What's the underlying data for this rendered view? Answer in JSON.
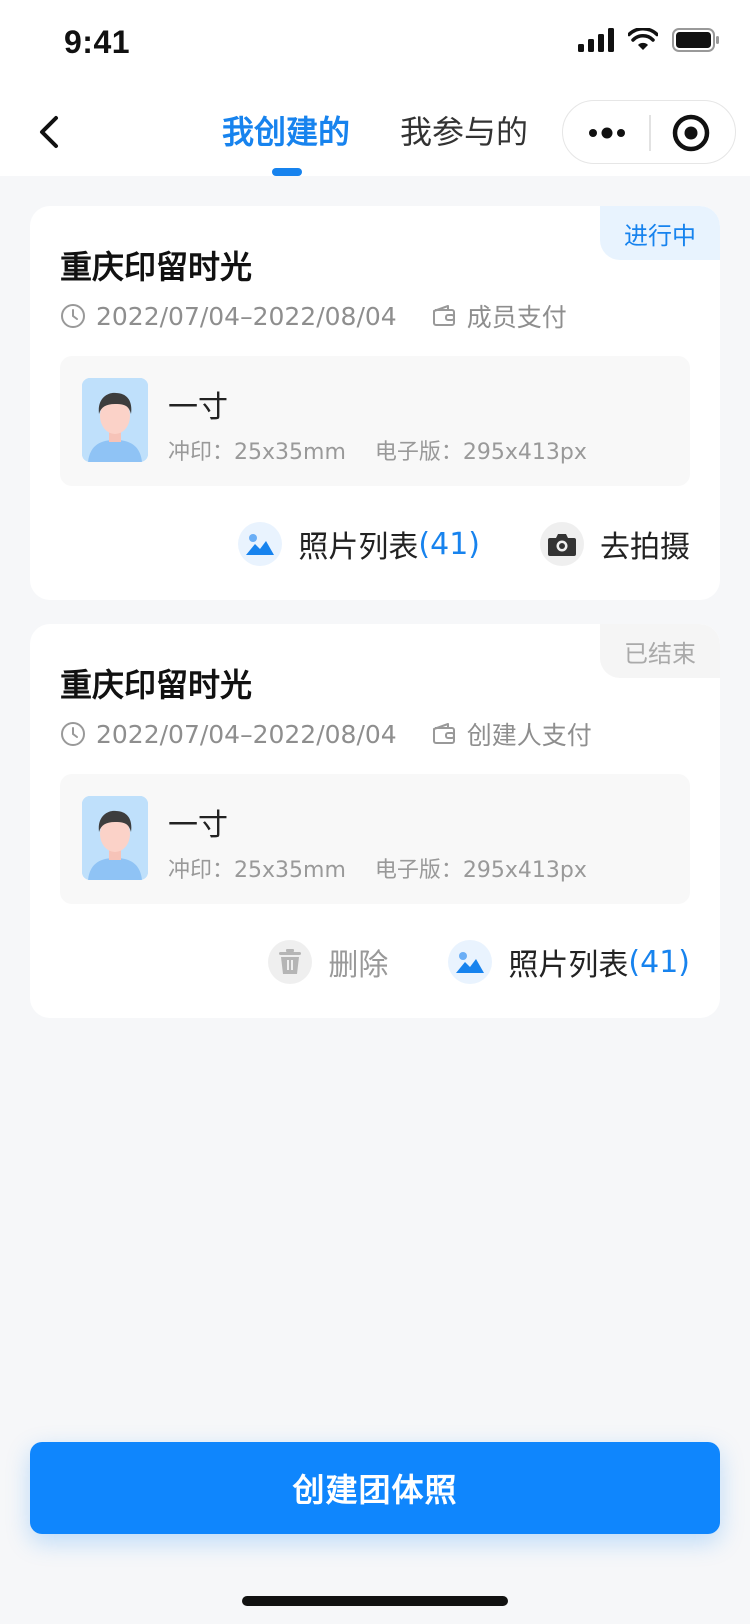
{
  "status_bar": {
    "time": "9:41"
  },
  "nav": {
    "tabs": [
      {
        "label": "我创建的",
        "active": true
      },
      {
        "label": "我参与的",
        "active": false
      }
    ]
  },
  "cards": [
    {
      "title": "重庆印留时光",
      "status": "进行中",
      "date_range": "2022/07/04–2022/08/04",
      "payment": "成员支付",
      "size": {
        "name": "一寸",
        "print": "冲印：25x35mm",
        "digital": "电子版：295x413px"
      },
      "actions": [
        {
          "label": "照片列表",
          "count": "(41)",
          "icon": "photo-icon"
        },
        {
          "label": "去拍摄",
          "count": "",
          "icon": "camera-icon"
        }
      ]
    },
    {
      "title": "重庆印留时光",
      "status": "已结束",
      "date_range": "2022/07/04–2022/08/04",
      "payment": "创建人支付",
      "size": {
        "name": "一寸",
        "print": "冲印：25x35mm",
        "digital": "电子版：295x413px"
      },
      "actions": [
        {
          "label": "删除",
          "count": "",
          "icon": "trash-icon"
        },
        {
          "label": "照片列表",
          "count": "(41)",
          "icon": "photo-icon"
        }
      ]
    }
  ],
  "primary_button": {
    "label": "创建团体照"
  },
  "colors": {
    "accent": "#1783ee",
    "button": "#0f86fd",
    "background": "#f6f7f9"
  }
}
